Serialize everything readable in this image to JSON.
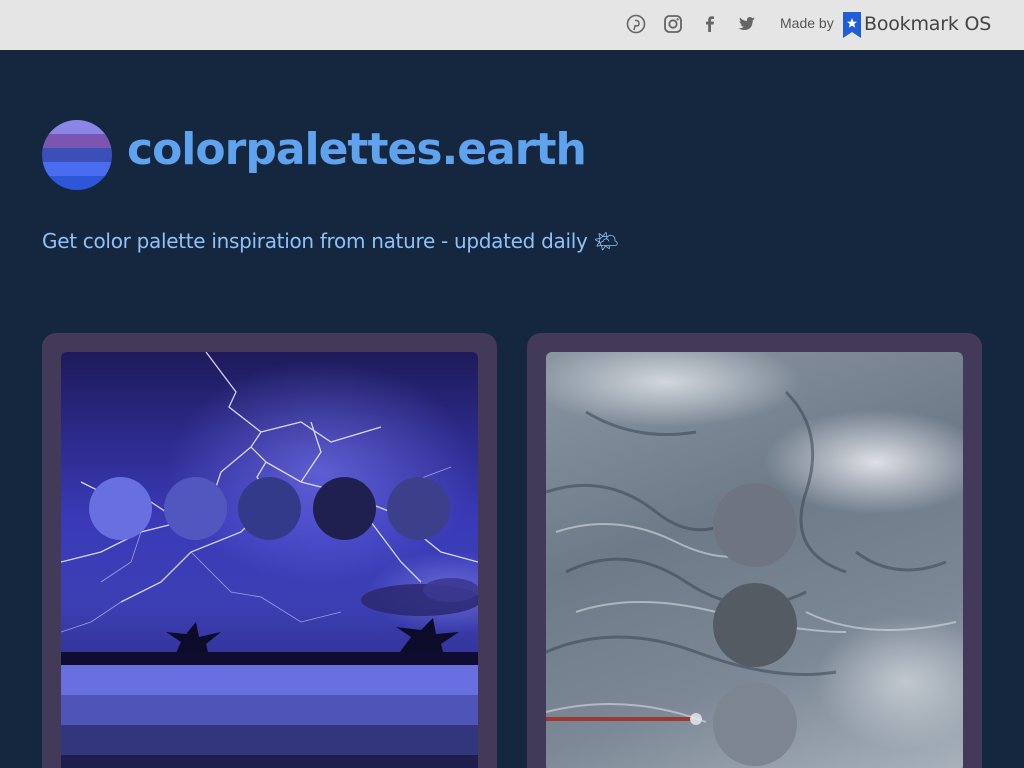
{
  "topbar": {
    "made_by_label": "Made by",
    "brand_name": "Bookmark OS",
    "brand_color": "#1f5ed6",
    "social_icons": [
      "pinterest-icon",
      "instagram-icon",
      "facebook-icon",
      "twitter-icon"
    ]
  },
  "header": {
    "site_title": "colorpalettes.earth",
    "tagline": "Get color palette inspiration from nature - updated daily 🌤",
    "logo_stripes": [
      "#8b86e6",
      "#7a55b2",
      "#3a4fb8",
      "#4a6cf0",
      "#2d56d8"
    ]
  },
  "cards": [
    {
      "theme": "lightning storm",
      "swatches": [
        "#6870e0",
        "#5257c0",
        "#343a8a",
        "#1f2050",
        "#3c3f8a"
      ],
      "bands": [
        "#6870e0",
        "#4f54b8",
        "#32367c",
        "#1d1e4c"
      ]
    },
    {
      "theme": "glacier aerial",
      "swatches": [
        "#6e7580",
        "#555b63",
        "#7d8591"
      ]
    }
  ]
}
